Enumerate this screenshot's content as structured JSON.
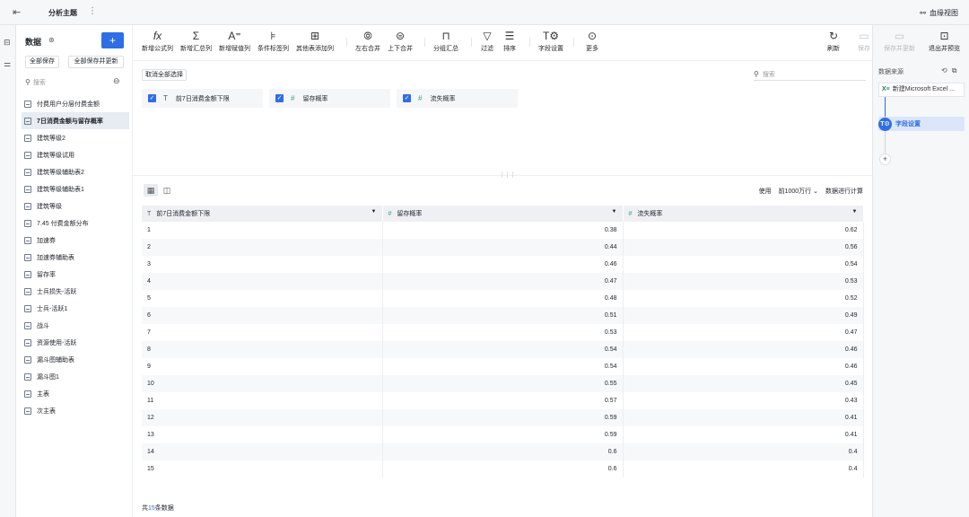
{
  "topbar": {
    "title": "分析主题",
    "blood_view": "血缘视图"
  },
  "data_panel": {
    "title": "数据",
    "save_all": "全部保存",
    "save_all_update": "全部保存并更新",
    "search_placeholder": "搜索",
    "items": [
      {
        "label": "付费用户分层付费金额",
        "active": false
      },
      {
        "label": "7日消费金额与留存概率",
        "active": true
      },
      {
        "label": "建筑等级2",
        "active": false
      },
      {
        "label": "建筑等级试用",
        "active": false
      },
      {
        "label": "建筑等级辅助表2",
        "active": false
      },
      {
        "label": "建筑等级辅助表1",
        "active": false
      },
      {
        "label": "建筑等级",
        "active": false
      },
      {
        "label": "7.45 付费金额分布",
        "active": false
      },
      {
        "label": "加速券",
        "active": false
      },
      {
        "label": "加速券辅助表",
        "active": false
      },
      {
        "label": "留存率",
        "active": false
      },
      {
        "label": "士兵损失-活跃",
        "active": false
      },
      {
        "label": "士兵-活跃1",
        "active": false
      },
      {
        "label": "战斗",
        "active": false
      },
      {
        "label": "资源使用-活跃",
        "active": false
      },
      {
        "label": "漏斗图辅助表",
        "active": false
      },
      {
        "label": "漏斗图1",
        "active": false
      },
      {
        "label": "主表",
        "active": false
      },
      {
        "label": "次主表",
        "active": false
      }
    ]
  },
  "toolbar": {
    "items": [
      {
        "label": "新增公式列",
        "icon": "fx-icon"
      },
      {
        "label": "新增汇总列",
        "icon": "sigma-icon"
      },
      {
        "label": "新增赋值列",
        "icon": "assign-icon"
      },
      {
        "label": "条件标签列",
        "icon": "condition-icon"
      },
      {
        "label": "其他表添加列",
        "icon": "add-column-icon"
      },
      {
        "label": "左右合并",
        "icon": "merge-lr-icon"
      },
      {
        "label": "上下合并",
        "icon": "merge-ud-icon"
      },
      {
        "label": "分组汇总",
        "icon": "group-icon"
      },
      {
        "label": "过滤",
        "icon": "filter-icon"
      },
      {
        "label": "排序",
        "icon": "sort-icon"
      },
      {
        "label": "字段设置",
        "icon": "field-settings-icon"
      },
      {
        "label": "更多",
        "icon": "more-icon"
      }
    ],
    "refresh": "刷新",
    "save": "保存",
    "save_update": "保存并更新",
    "exit_preview": "退出并预览"
  },
  "fields": {
    "cancel_all": "取消全部选择",
    "search_placeholder": "搜索",
    "chips": [
      {
        "label": "前7日消费金额下限",
        "type": "text"
      },
      {
        "label": "留存概率",
        "type": "number"
      },
      {
        "label": "流失概率",
        "type": "number"
      }
    ]
  },
  "preview": {
    "use_label": "使用",
    "rows_option": "前1000万行",
    "compute_label": "数据进行计算",
    "columns": [
      {
        "label": "前7日消费金额下限",
        "type": "text"
      },
      {
        "label": "留存概率",
        "type": "number"
      },
      {
        "label": "流失概率",
        "type": "number"
      }
    ],
    "rows": [
      [
        "1",
        "0.38",
        "0.62"
      ],
      [
        "2",
        "0.44",
        "0.56"
      ],
      [
        "3",
        "0.46",
        "0.54"
      ],
      [
        "4",
        "0.47",
        "0.53"
      ],
      [
        "5",
        "0.48",
        "0.52"
      ],
      [
        "6",
        "0.51",
        "0.49"
      ],
      [
        "7",
        "0.53",
        "0.47"
      ],
      [
        "8",
        "0.54",
        "0.46"
      ],
      [
        "9",
        "0.54",
        "0.46"
      ],
      [
        "10",
        "0.55",
        "0.45"
      ],
      [
        "11",
        "0.57",
        "0.43"
      ],
      [
        "12",
        "0.59",
        "0.41"
      ],
      [
        "13",
        "0.59",
        "0.41"
      ],
      [
        "14",
        "0.6",
        "0.4"
      ],
      [
        "15",
        "0.6",
        "0.4"
      ]
    ],
    "total_prefix": "共",
    "total_count": "15",
    "total_suffix": "条数据"
  },
  "right_panel": {
    "title": "数据来源",
    "source": "新建Microsoft Excel ...",
    "step": "字段设置",
    "step_icon_text": "T⚙"
  }
}
